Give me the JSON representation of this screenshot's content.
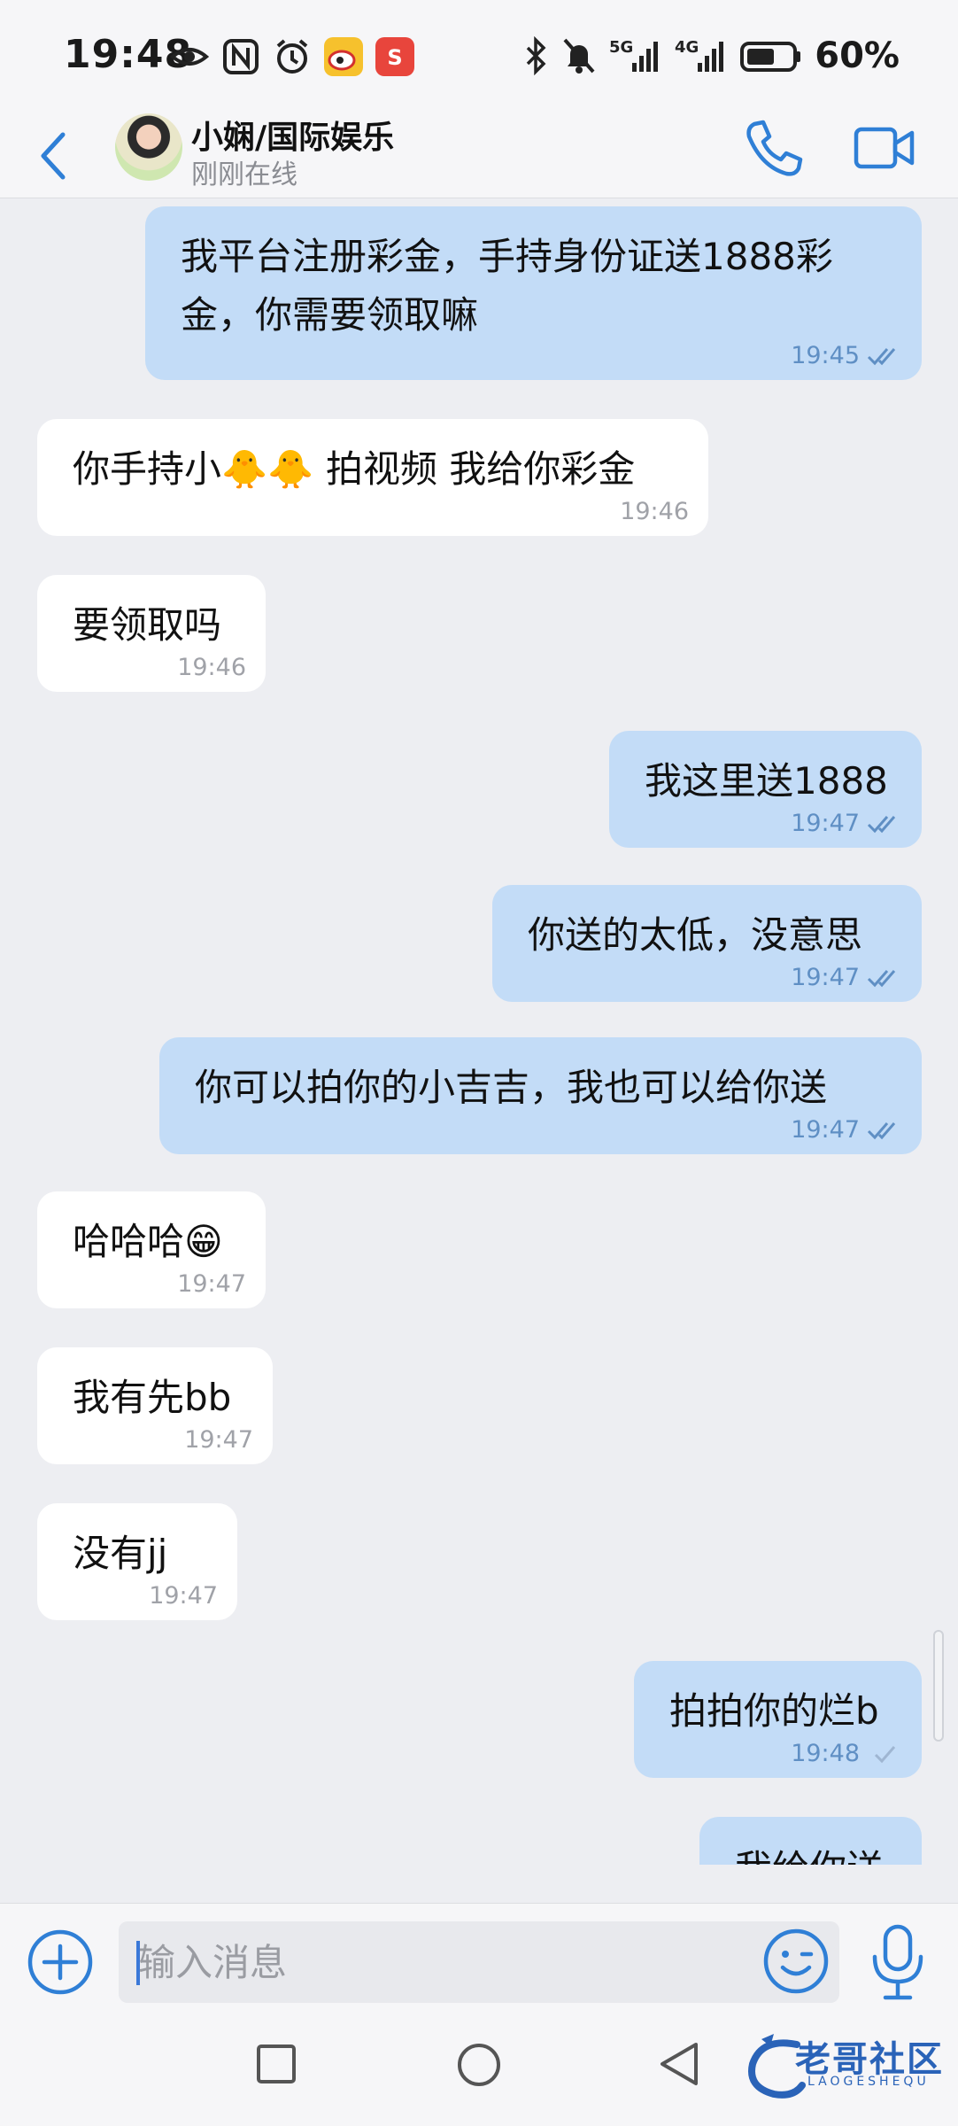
{
  "status_bar": {
    "time": "19:48",
    "battery": "60%",
    "net_5g": "5G",
    "net_4g": "4G",
    "left_icons": [
      "eye-icon",
      "nfc-icon",
      "alarm-icon",
      "weibo-icon",
      "app-s-icon"
    ],
    "right_icons": [
      "bluetooth-icon",
      "mute-icon",
      "signal-5g-icon",
      "signal-4g-icon",
      "battery-icon"
    ]
  },
  "header": {
    "contact_name": "小娴/国际娱乐",
    "contact_status": "刚刚在线",
    "accent_color": "#2f7fd6"
  },
  "messages": [
    {
      "dir": "out",
      "text": "我平台注册彩金，手持身份证送1888彩金，你需要领取嘛",
      "time": "19:45",
      "status": "read"
    },
    {
      "dir": "in",
      "text": "你手持小🐥🐥 拍视频 我给你彩金",
      "time": "19:46"
    },
    {
      "dir": "in",
      "text": "要领取吗",
      "time": "19:46"
    },
    {
      "dir": "out",
      "text": "我这里送1888",
      "time": "19:47",
      "status": "read"
    },
    {
      "dir": "out",
      "text": "你送的太低，没意思",
      "time": "19:47",
      "status": "read"
    },
    {
      "dir": "out",
      "text": "你可以拍你的小吉吉，我也可以给你送",
      "time": "19:47",
      "status": "read"
    },
    {
      "dir": "in",
      "text": "哈哈哈😁",
      "time": "19:47"
    },
    {
      "dir": "in",
      "text": "我有先bb",
      "time": "19:47"
    },
    {
      "dir": "in",
      "text": "没有jj",
      "time": "19:47"
    },
    {
      "dir": "out",
      "text": "拍拍你的烂b",
      "time": "19:48",
      "status": "sent"
    },
    {
      "dir": "out",
      "text": "我给你送",
      "time": "",
      "status": ""
    }
  ],
  "input": {
    "placeholder": "输入消息"
  },
  "watermark": {
    "text": "老哥社区",
    "sub": "LAOGESHEQU"
  },
  "colors": {
    "outgoing_bubble": "#c3dcf7",
    "incoming_bubble": "#ffffff",
    "background": "#edeef2",
    "read_tick": "#5f8fc4"
  }
}
